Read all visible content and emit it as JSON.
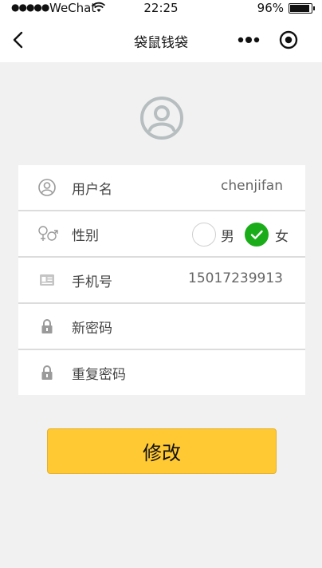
{
  "status_bar": {
    "carrier": "WeChat",
    "time": "22:25",
    "battery": "96%"
  },
  "nav": {
    "title": "袋鼠钱袋"
  },
  "form": {
    "username": {
      "label": "用户名",
      "value": "chenjifan"
    },
    "gender": {
      "label": "性别",
      "male": "男",
      "female": "女",
      "selected": "女"
    },
    "phone": {
      "label": "手机号",
      "value": "15017239913"
    },
    "new_password": {
      "label": "新密码",
      "value": ""
    },
    "repeat_password": {
      "label": "重复密码",
      "value": ""
    }
  },
  "submit_label": "修改",
  "colors": {
    "accent": "#ffc933",
    "checked": "#1aad19"
  }
}
